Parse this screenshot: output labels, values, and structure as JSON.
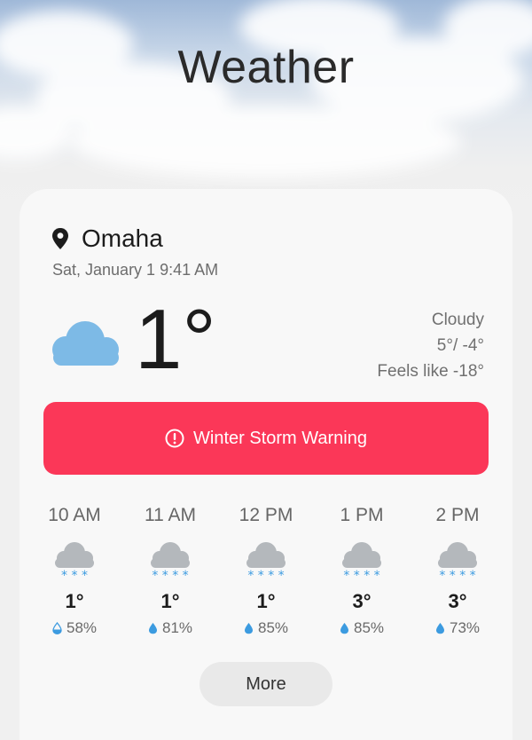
{
  "app": {
    "title": "Weather"
  },
  "location": {
    "city": "Omaha",
    "datetime": "Sat, January 1 9:41 AM",
    "pin_icon": "location-pin-icon"
  },
  "current": {
    "icon": "cloud-icon",
    "temperature": "1°",
    "condition": "Cloudy",
    "high_low": "5°/ -4°",
    "feels_like": "Feels like -18°"
  },
  "alert": {
    "icon": "alert-icon",
    "label": "Winter Storm Warning",
    "color": "#fb3758"
  },
  "hourly": [
    {
      "time": "10 AM",
      "icon": "snow-cloud-icon",
      "flakes": "* * *",
      "temp": "1°",
      "precip": "58%",
      "drop": "half"
    },
    {
      "time": "11 AM",
      "icon": "snow-cloud-icon",
      "flakes": "* * * *",
      "temp": "1°",
      "precip": "81%",
      "drop": "full"
    },
    {
      "time": "12 PM",
      "icon": "snow-cloud-icon",
      "flakes": "* * * *",
      "temp": "1°",
      "precip": "85%",
      "drop": "full"
    },
    {
      "time": "1 PM",
      "icon": "snow-cloud-icon",
      "flakes": "* * * *",
      "temp": "3°",
      "precip": "85%",
      "drop": "full"
    },
    {
      "time": "2 PM",
      "icon": "snow-cloud-icon",
      "flakes": "* * * *",
      "temp": "3°",
      "precip": "73%",
      "drop": "full"
    }
  ],
  "more_button": {
    "label": "More"
  },
  "colors": {
    "cloud_blue": "#7dbae6",
    "snow_blue": "#3c9be0",
    "cloud_grey": "#b4b8bc",
    "card_bg": "#f8f8f8"
  }
}
